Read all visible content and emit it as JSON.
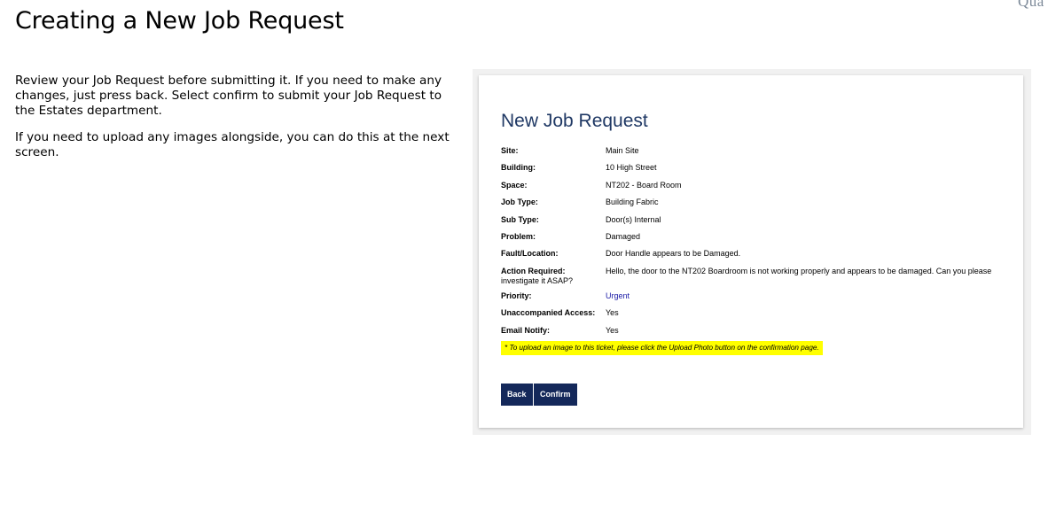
{
  "corner_text": "Qua",
  "slide_title": "Creating a New Job Request",
  "instructions": {
    "paragraph1": "Review your Job Request before submitting it. If you need to make any changes, just press back. Select confirm to submit your Job Request to the Estates department.",
    "paragraph2": "If you need to upload any images alongside, you can do this at the next screen."
  },
  "form": {
    "title": "New Job Request",
    "rows": [
      {
        "label": "Site:",
        "value": "Main Site"
      },
      {
        "label": "Building:",
        "value": "10 High Street"
      },
      {
        "label": "Space:",
        "value": "NT202 - Board Room"
      },
      {
        "label": "Job Type:",
        "value": "Building Fabric"
      },
      {
        "label": "Sub Type:",
        "value": "Door(s) Internal"
      },
      {
        "label": "Problem:",
        "value": "Damaged"
      },
      {
        "label": "Fault/Location:",
        "value": "Door Handle appears to be Damaged."
      }
    ],
    "action": {
      "label": "Action Required:",
      "value_line1": "Hello, the door to the NT202 Boardroom is not working properly and appears to be damaged. Can you please",
      "value_line2": "investigate it ASAP?"
    },
    "rows_after": [
      {
        "label": "Priority:",
        "value": "Urgent"
      },
      {
        "label": "Unaccompanied Access:",
        "value": "Yes"
      },
      {
        "label": "Email Notify:",
        "value": "Yes"
      }
    ],
    "note": "* To upload an image to this ticket, please click the Upload Photo button on the confirmation page.",
    "back_label": "Back",
    "confirm_label": "Confirm"
  },
  "colors": {
    "form_title": "#1f3864",
    "button_bg": "#14285a",
    "urgent": "#1a1aa6",
    "highlight": "#ffff00"
  }
}
